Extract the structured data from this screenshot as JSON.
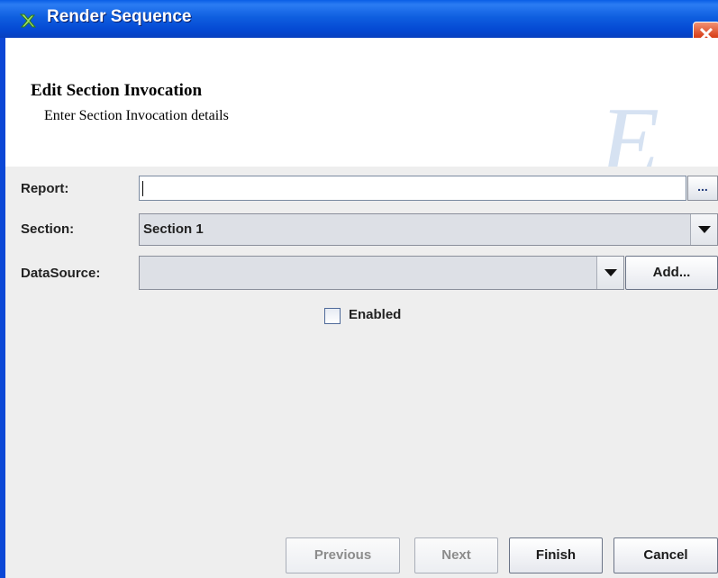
{
  "window": {
    "title": "Render Sequence",
    "close_glyph": "✕",
    "app_icon": "render-sequence-icon",
    "colors": {
      "titlebar": "#0a5ee6",
      "close_button": "#d9421c",
      "panel": "#eeeeee"
    }
  },
  "banner": {
    "title": "Edit Section Invocation",
    "subtitle": "Enter Section Invocation details",
    "logo_letter": "E"
  },
  "form": {
    "report": {
      "label": "Report:",
      "value": "",
      "browse_label": "..."
    },
    "section": {
      "label": "Section:",
      "value": "Section 1"
    },
    "datasource": {
      "label": "DataSource:",
      "value": "",
      "add_label": "Add..."
    },
    "enabled": {
      "label": "Enabled",
      "checked": false
    }
  },
  "buttons": {
    "previous": "Previous",
    "next": "Next",
    "finish": "Finish",
    "cancel": "Cancel"
  }
}
